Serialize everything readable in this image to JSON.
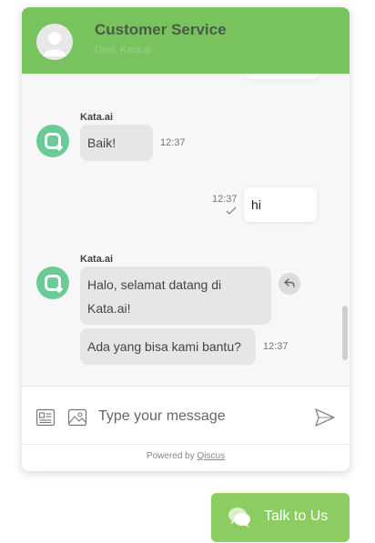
{
  "header": {
    "title": "Customer Service",
    "subtitle": "Desi, Kata.ai"
  },
  "messages": [
    {
      "sender": "Kata.ai",
      "direction": "incoming",
      "text": "Baik!",
      "time": "12:37"
    },
    {
      "direction": "outgoing",
      "text": "hi",
      "time": "12:37",
      "status": "delivered"
    },
    {
      "sender": "Kata.ai",
      "direction": "incoming",
      "text": "Halo, selamat datang di Kata.ai!",
      "line1": "Halo, selamat datang di",
      "line2": "Kata.ai!"
    },
    {
      "direction": "incoming",
      "text": "Ada yang bisa kami bantu?",
      "time": "12:37"
    }
  ],
  "composer": {
    "placeholder": "Type your message"
  },
  "footer": {
    "powered_by": "Powered by",
    "brand": "Qiscus"
  },
  "launcher": {
    "label": "Talk to Us"
  },
  "colors": {
    "header_green": "#79c35e",
    "launcher_green": "#8ccd62",
    "bot_avatar": "#6bcb96",
    "chat_background": "#f7f7f7"
  },
  "icons": {
    "header_avatar": "user-silhouette-icon",
    "bot_avatar": "kata-q-logo-icon",
    "read_status": "check-icon",
    "reply": "reply-icon",
    "attach_document": "document-icon",
    "attach_image": "image-icon",
    "send": "send-icon",
    "launcher": "chat-bubbles-icon"
  }
}
